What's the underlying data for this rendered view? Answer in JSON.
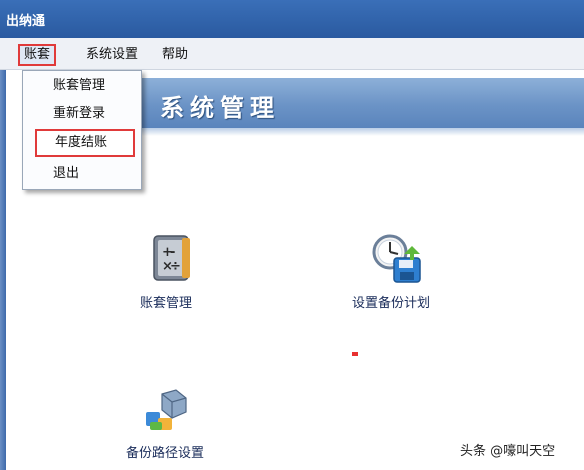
{
  "window": {
    "title": "出纳通"
  },
  "menubar": {
    "items": [
      "账套",
      "系统设置",
      "帮助"
    ]
  },
  "dropdown": {
    "items": [
      "账套管理",
      "重新登录",
      "年度结账",
      "退出"
    ]
  },
  "header": {
    "title": "系统管理"
  },
  "icons": [
    {
      "label": "账套管理",
      "icon": "ledger-book-icon"
    },
    {
      "label": "设置备份计划",
      "icon": "backup-schedule-icon"
    },
    {
      "label": "备份路径设置",
      "icon": "backup-path-icon"
    }
  ],
  "watermark": "头条 @嚎叫天空",
  "colors": {
    "titlebar": "#2a5aa0",
    "header": "#6b93c6",
    "highlight": "#e03a3a"
  }
}
